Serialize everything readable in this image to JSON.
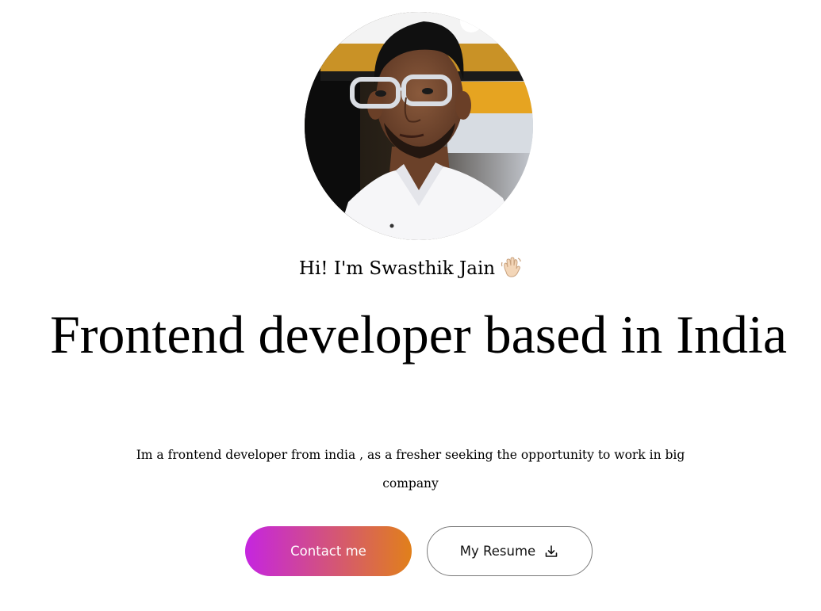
{
  "profile": {
    "name_greeting": "Hi! I'm Swasthik Jain",
    "avatar_alt": "Swasthik Jain portrait"
  },
  "hero": {
    "headline": "Frontend developer based in India",
    "intro": "Im a frontend developer from india , as a fresher seeking the opportunity to work in big company"
  },
  "actions": {
    "contact_label": "Contact me",
    "resume_label": "My Resume"
  },
  "icons": {
    "greeting_icon": "waving-hand-icon",
    "resume_icon": "download-icon"
  },
  "colors": {
    "contact_gradient_start": "#c525e0",
    "contact_gradient_end": "#e1801a",
    "text": "#000000"
  }
}
